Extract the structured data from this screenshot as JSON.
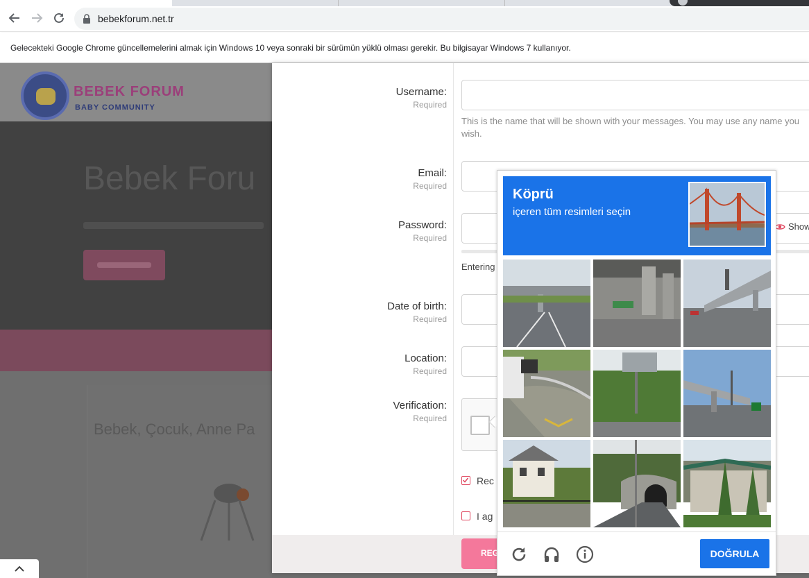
{
  "browser": {
    "url": "bebekforum.net.tr",
    "infobar": "Gelecekteki Google Chrome güncellemelerini almak için Windows 10 veya sonraki bir sürümün yüklü olması gerekir. Bu bilgisayar Windows 7 kullanıyor."
  },
  "site": {
    "logo_line1": "BEBEK FORUM",
    "logo_line2": "BABY COMMUNITY",
    "hero_title": "Bebek Foru",
    "content_title": "Bebek, Çocuk, Anne Pa"
  },
  "form": {
    "required": "Required",
    "username_label": "Username:",
    "username_hint": "This is the name that will be shown with your messages. You may use any name you wish.",
    "email_label": "Email:",
    "password_label": "Password:",
    "show_label": "Show",
    "entering_text": "Entering",
    "dob_label": "Date of birth:",
    "location_label": "Location:",
    "verification_label": "Verification:",
    "check1_text": "Rec",
    "check2_text": "I ag",
    "register_label": "REG"
  },
  "captcha": {
    "title": "Köprü",
    "subtitle": "içeren tüm resimleri seçin",
    "verify_label": "DOĞRULA",
    "tiles": [
      "highway overpass",
      "highway overpass under",
      "highway overpass side",
      "curved guardrail road",
      "road sign trees",
      "overpass sky",
      "house with fence",
      "tunnel entrance",
      "building with trees"
    ]
  }
}
